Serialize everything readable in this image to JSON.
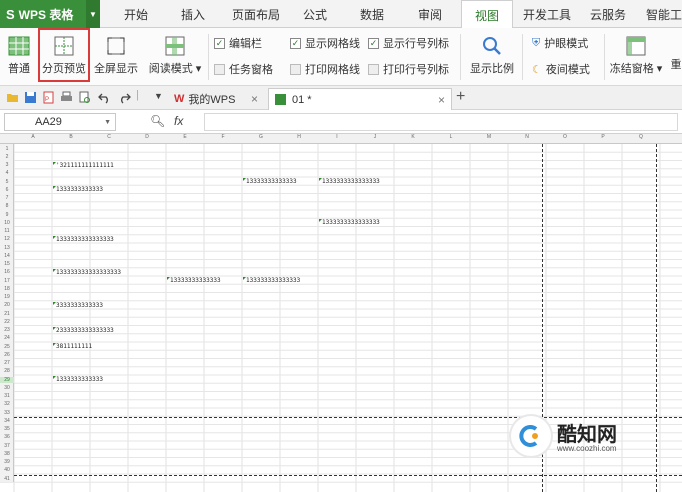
{
  "app": {
    "name": "WPS 表格",
    "logo": "S"
  },
  "menu_tabs": [
    "开始",
    "插入",
    "页面布局",
    "公式",
    "数据",
    "审阅",
    "视图",
    "开发工具",
    "云服务",
    "智能工具"
  ],
  "active_menu_tab": "视图",
  "ribbon": {
    "normal": "普通",
    "page_preview": "分页预览",
    "fullscreen": "全屏显示",
    "reading_mode": "阅读模式",
    "edit_bar": "编辑栏",
    "task_pane": "任务窗格",
    "show_gridlines": "显示网格线",
    "print_gridlines": "打印网格线",
    "show_row_col": "显示行号列标",
    "print_row_col": "打印行号列标",
    "zoom": "显示比例",
    "eye_mode": "护眼模式",
    "night_mode": "夜间模式",
    "freeze": "冻结窗格",
    "rearrange": "重"
  },
  "doc_tabs": {
    "my_wps": "我的WPS",
    "current": "01 *"
  },
  "formula_bar": {
    "cell_ref": "AA29",
    "fx": "fx"
  },
  "columns": [
    "A",
    "B",
    "C",
    "D",
    "E",
    "F",
    "G",
    "H",
    "I",
    "J",
    "K",
    "L",
    "M",
    "N",
    "O",
    "P",
    "Q"
  ],
  "rows": [
    "1",
    "2",
    "3",
    "4",
    "5",
    "6",
    "7",
    "8",
    "9",
    "10",
    "11",
    "12",
    "13",
    "14",
    "15",
    "16",
    "17",
    "18",
    "19",
    "20",
    "21",
    "22",
    "23",
    "24",
    "25",
    "26",
    "27",
    "28",
    "29",
    "30",
    "31",
    "32",
    "33",
    "34",
    "35",
    "36",
    "37",
    "38",
    "39",
    "40",
    "41"
  ],
  "cells": [
    {
      "text": "'321111111111111",
      "row": 3,
      "col": 1
    },
    {
      "text": "13333333333333",
      "row": 5,
      "col": 6
    },
    {
      "text": "1333333333333333",
      "row": 5,
      "col": 8
    },
    {
      "text": "1333333333333",
      "row": 6,
      "col": 1
    },
    {
      "text": "1333333333333333",
      "row": 10,
      "col": 8
    },
    {
      "text": "1333333333333333",
      "row": 12,
      "col": 1
    },
    {
      "text": "133333333333333333",
      "row": 16,
      "col": 1
    },
    {
      "text": "13333333333333",
      "row": 17,
      "col": 4
    },
    {
      "text": "133333333333333",
      "row": 17,
      "col": 6
    },
    {
      "text": "3333333333333",
      "row": 20,
      "col": 1
    },
    {
      "text": "2333333333333333",
      "row": 23,
      "col": 1
    },
    {
      "text": "3811111111",
      "row": 25,
      "col": 1
    },
    {
      "text": "1333333333333",
      "row": 29,
      "col": 1
    }
  ],
  "watermark": {
    "brand": "酷知网",
    "url": "www.coozhi.com"
  }
}
